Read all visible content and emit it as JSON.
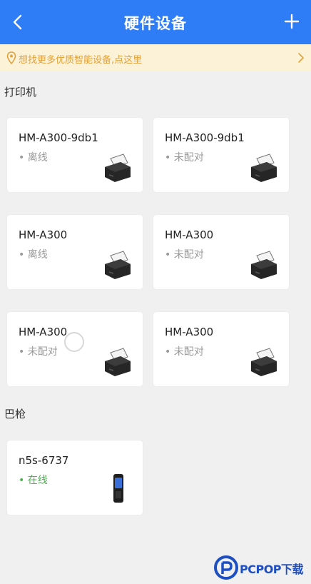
{
  "header": {
    "title": "硬件设备",
    "back_icon": "chevron-left-icon",
    "add_icon": "plus-icon",
    "color": "#2e7cf6"
  },
  "notice": {
    "text": "想找更多优质智能设备,点这里",
    "icon": "location-pin-icon",
    "arrow_icon": "chevron-right-icon",
    "color": "#e2a23a",
    "background": "#fcf2d8"
  },
  "sections": {
    "printers": {
      "title": "打印机",
      "devices": [
        {
          "name": "HM-A300-9db1",
          "status": "• 离线"
        },
        {
          "name": "HM-A300-9db1",
          "status": "• 未配对"
        },
        {
          "name": "HM-A300",
          "status": "• 离线"
        },
        {
          "name": "HM-A300",
          "status": "• 未配对"
        },
        {
          "name": "HM-A300",
          "status": "• 未配对"
        },
        {
          "name": "HM-A300",
          "status": "• 未配对"
        }
      ]
    },
    "scanners": {
      "title": "巴枪",
      "devices": [
        {
          "name": "n5s-6737",
          "status": "• 在线",
          "status_color": "#4caf50"
        }
      ]
    }
  },
  "watermark": {
    "text": "PCPOP下载"
  }
}
